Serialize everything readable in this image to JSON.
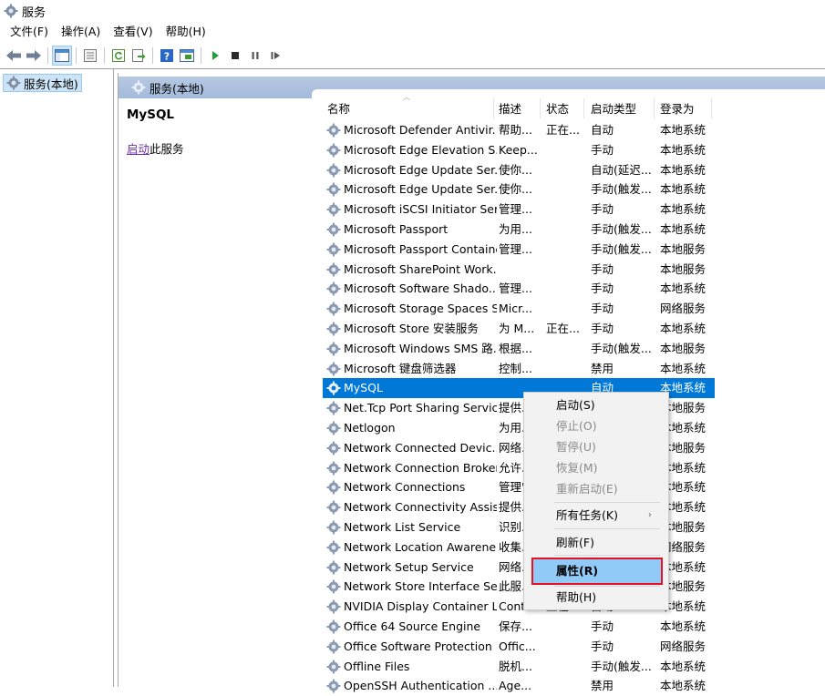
{
  "window": {
    "title": "服务"
  },
  "menu": [
    "文件(F)",
    "操作(A)",
    "查看(V)",
    "帮助(H)"
  ],
  "toolbar": [
    "back-icon",
    "forward-icon",
    "show-tree-icon",
    "properties-icon",
    "refresh-icon",
    "export-icon",
    "help-icon",
    "console-icon",
    "start-service-icon",
    "stop-service-icon",
    "pause-service-icon",
    "resume-service-icon"
  ],
  "tree": {
    "root": "服务(本地)"
  },
  "panel": {
    "header": "服务(本地)",
    "service_name": "MySQL",
    "start_link": "启动",
    "start_suffix": "此服务"
  },
  "columns": {
    "name": "名称",
    "desc": "描述",
    "status": "状态",
    "startup": "启动类型",
    "logon": "登录为"
  },
  "rows": [
    {
      "name": "Microsoft Defender Antivir...",
      "desc": "帮助...",
      "status": "正在...",
      "startup": "自动",
      "logon": "本地系统"
    },
    {
      "name": "Microsoft Edge Elevation S...",
      "desc": "Keep...",
      "status": "",
      "startup": "手动",
      "logon": "本地系统"
    },
    {
      "name": "Microsoft Edge Update Ser...",
      "desc": "使你...",
      "status": "",
      "startup": "自动(延迟...",
      "logon": "本地系统"
    },
    {
      "name": "Microsoft Edge Update Ser...",
      "desc": "使你...",
      "status": "",
      "startup": "手动(触发...",
      "logon": "本地系统"
    },
    {
      "name": "Microsoft iSCSI Initiator Ser...",
      "desc": "管理...",
      "status": "",
      "startup": "手动",
      "logon": "本地系统"
    },
    {
      "name": "Microsoft Passport",
      "desc": "为用...",
      "status": "",
      "startup": "手动(触发...",
      "logon": "本地系统"
    },
    {
      "name": "Microsoft Passport Container",
      "desc": "管理...",
      "status": "",
      "startup": "手动(触发...",
      "logon": "本地服务"
    },
    {
      "name": "Microsoft SharePoint Work...",
      "desc": "",
      "status": "",
      "startup": "手动",
      "logon": "本地服务"
    },
    {
      "name": "Microsoft Software Shado...",
      "desc": "管理...",
      "status": "",
      "startup": "手动",
      "logon": "本地系统"
    },
    {
      "name": "Microsoft Storage Spaces S...",
      "desc": "Micr...",
      "status": "",
      "startup": "手动",
      "logon": "网络服务"
    },
    {
      "name": "Microsoft Store 安装服务",
      "desc": "为 M...",
      "status": "正在...",
      "startup": "手动",
      "logon": "本地系统"
    },
    {
      "name": "Microsoft Windows SMS 路...",
      "desc": "根据...",
      "status": "",
      "startup": "手动(触发...",
      "logon": "本地服务"
    },
    {
      "name": "Microsoft 键盘筛选器",
      "desc": "控制...",
      "status": "",
      "startup": "禁用",
      "logon": "本地系统"
    },
    {
      "name": "MySQL",
      "desc": "",
      "status": "",
      "startup": "自动",
      "logon": "本地系统"
    },
    {
      "name": "Net.Tcp Port Sharing Service",
      "desc": "提供...",
      "status": "",
      "startup": "",
      "logon": "本地服务"
    },
    {
      "name": "Netlogon",
      "desc": "为用...",
      "status": "",
      "startup": "",
      "logon": "本地系统"
    },
    {
      "name": "Network Connected Devic...",
      "desc": "网络...",
      "status": "",
      "startup": "",
      "logon": "本地服务"
    },
    {
      "name": "Network Connection Broker",
      "desc": "允许...",
      "status": "",
      "startup": "",
      "logon": "本地系统"
    },
    {
      "name": "Network Connections",
      "desc": "管理\"...",
      "status": "",
      "startup": "",
      "logon": "本地系统"
    },
    {
      "name": "Network Connectivity Assis...",
      "desc": "提供...",
      "status": "",
      "startup": "",
      "logon": "本地系统"
    },
    {
      "name": "Network List Service",
      "desc": "识别...",
      "status": "",
      "startup": "",
      "logon": "本地服务"
    },
    {
      "name": "Network Location Awarene...",
      "desc": "收集...",
      "status": "",
      "startup": "",
      "logon": "网络服务"
    },
    {
      "name": "Network Setup Service",
      "desc": "网络...",
      "status": "",
      "startup": "",
      "logon": "本地系统"
    },
    {
      "name": "Network Store Interface Se...",
      "desc": "此服...",
      "status": "",
      "startup": "",
      "logon": "本地服务"
    },
    {
      "name": "NVIDIA Display Container LS",
      "desc": "Cont...",
      "status": "正在...",
      "startup": "自动",
      "logon": "本地系统"
    },
    {
      "name": "Office 64 Source Engine",
      "desc": "保存...",
      "status": "",
      "startup": "手动",
      "logon": "本地系统"
    },
    {
      "name": "Office Software Protection ...",
      "desc": "Offic...",
      "status": "",
      "startup": "手动",
      "logon": "网络服务"
    },
    {
      "name": "Offline Files",
      "desc": "脱机...",
      "status": "",
      "startup": "手动(触发...",
      "logon": "本地系统"
    },
    {
      "name": "OpenSSH Authentication ...",
      "desc": "Age...",
      "status": "",
      "startup": "禁用",
      "logon": "本地系统"
    }
  ],
  "selected_row": 13,
  "context_menu": {
    "start": "启动(S)",
    "stop": "停止(O)",
    "pause": "暂停(U)",
    "resume": "恢复(M)",
    "restart": "重新启动(E)",
    "all_tasks": "所有任务(K)",
    "refresh": "刷新(F)",
    "properties": "属性(R)",
    "help": "帮助(H)"
  },
  "colors": {
    "selection": "#0078d7",
    "menu_highlight": "#91c9f7",
    "highlight_box": "#e81123",
    "panel_header": "#a9bfdd"
  }
}
